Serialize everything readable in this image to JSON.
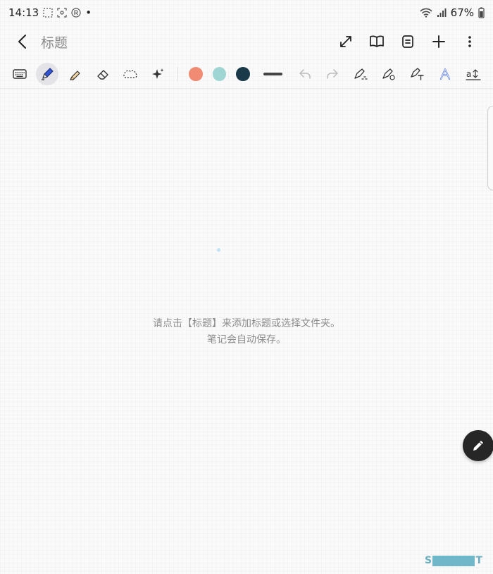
{
  "status": {
    "time": "14:13",
    "dot": "•",
    "battery": "67%"
  },
  "header": {
    "title": "标题"
  },
  "toolbar": {
    "colors": {
      "coral": "#f28b74",
      "teal": "#9fd6d4",
      "navy": "#1a3a4a"
    }
  },
  "hint": {
    "line1": "请点击【标题】来添加标题或选择文件夹。",
    "line2": "笔记会自动保存。"
  },
  "watermark": {
    "left": "S",
    "right": "T"
  },
  "icons": {
    "status": [
      "grid-icon",
      "screenshot-icon",
      "registered-icon",
      "wifi-icon",
      "signal-icon",
      "battery-icon"
    ],
    "header": [
      "back-icon",
      "expand-icon",
      "book-icon",
      "list-icon",
      "plus-icon",
      "more-icon"
    ],
    "tools": [
      "keyboard-icon",
      "pen-icon",
      "highlighter-icon",
      "eraser-icon",
      "lasso-icon",
      "sparkle-icon",
      "undo-icon",
      "redo-icon",
      "shape-icon",
      "pen-settings-icon",
      "handwriting-to-text-icon",
      "text-style-icon",
      "text-size-icon"
    ],
    "fab": "pencil-icon"
  }
}
